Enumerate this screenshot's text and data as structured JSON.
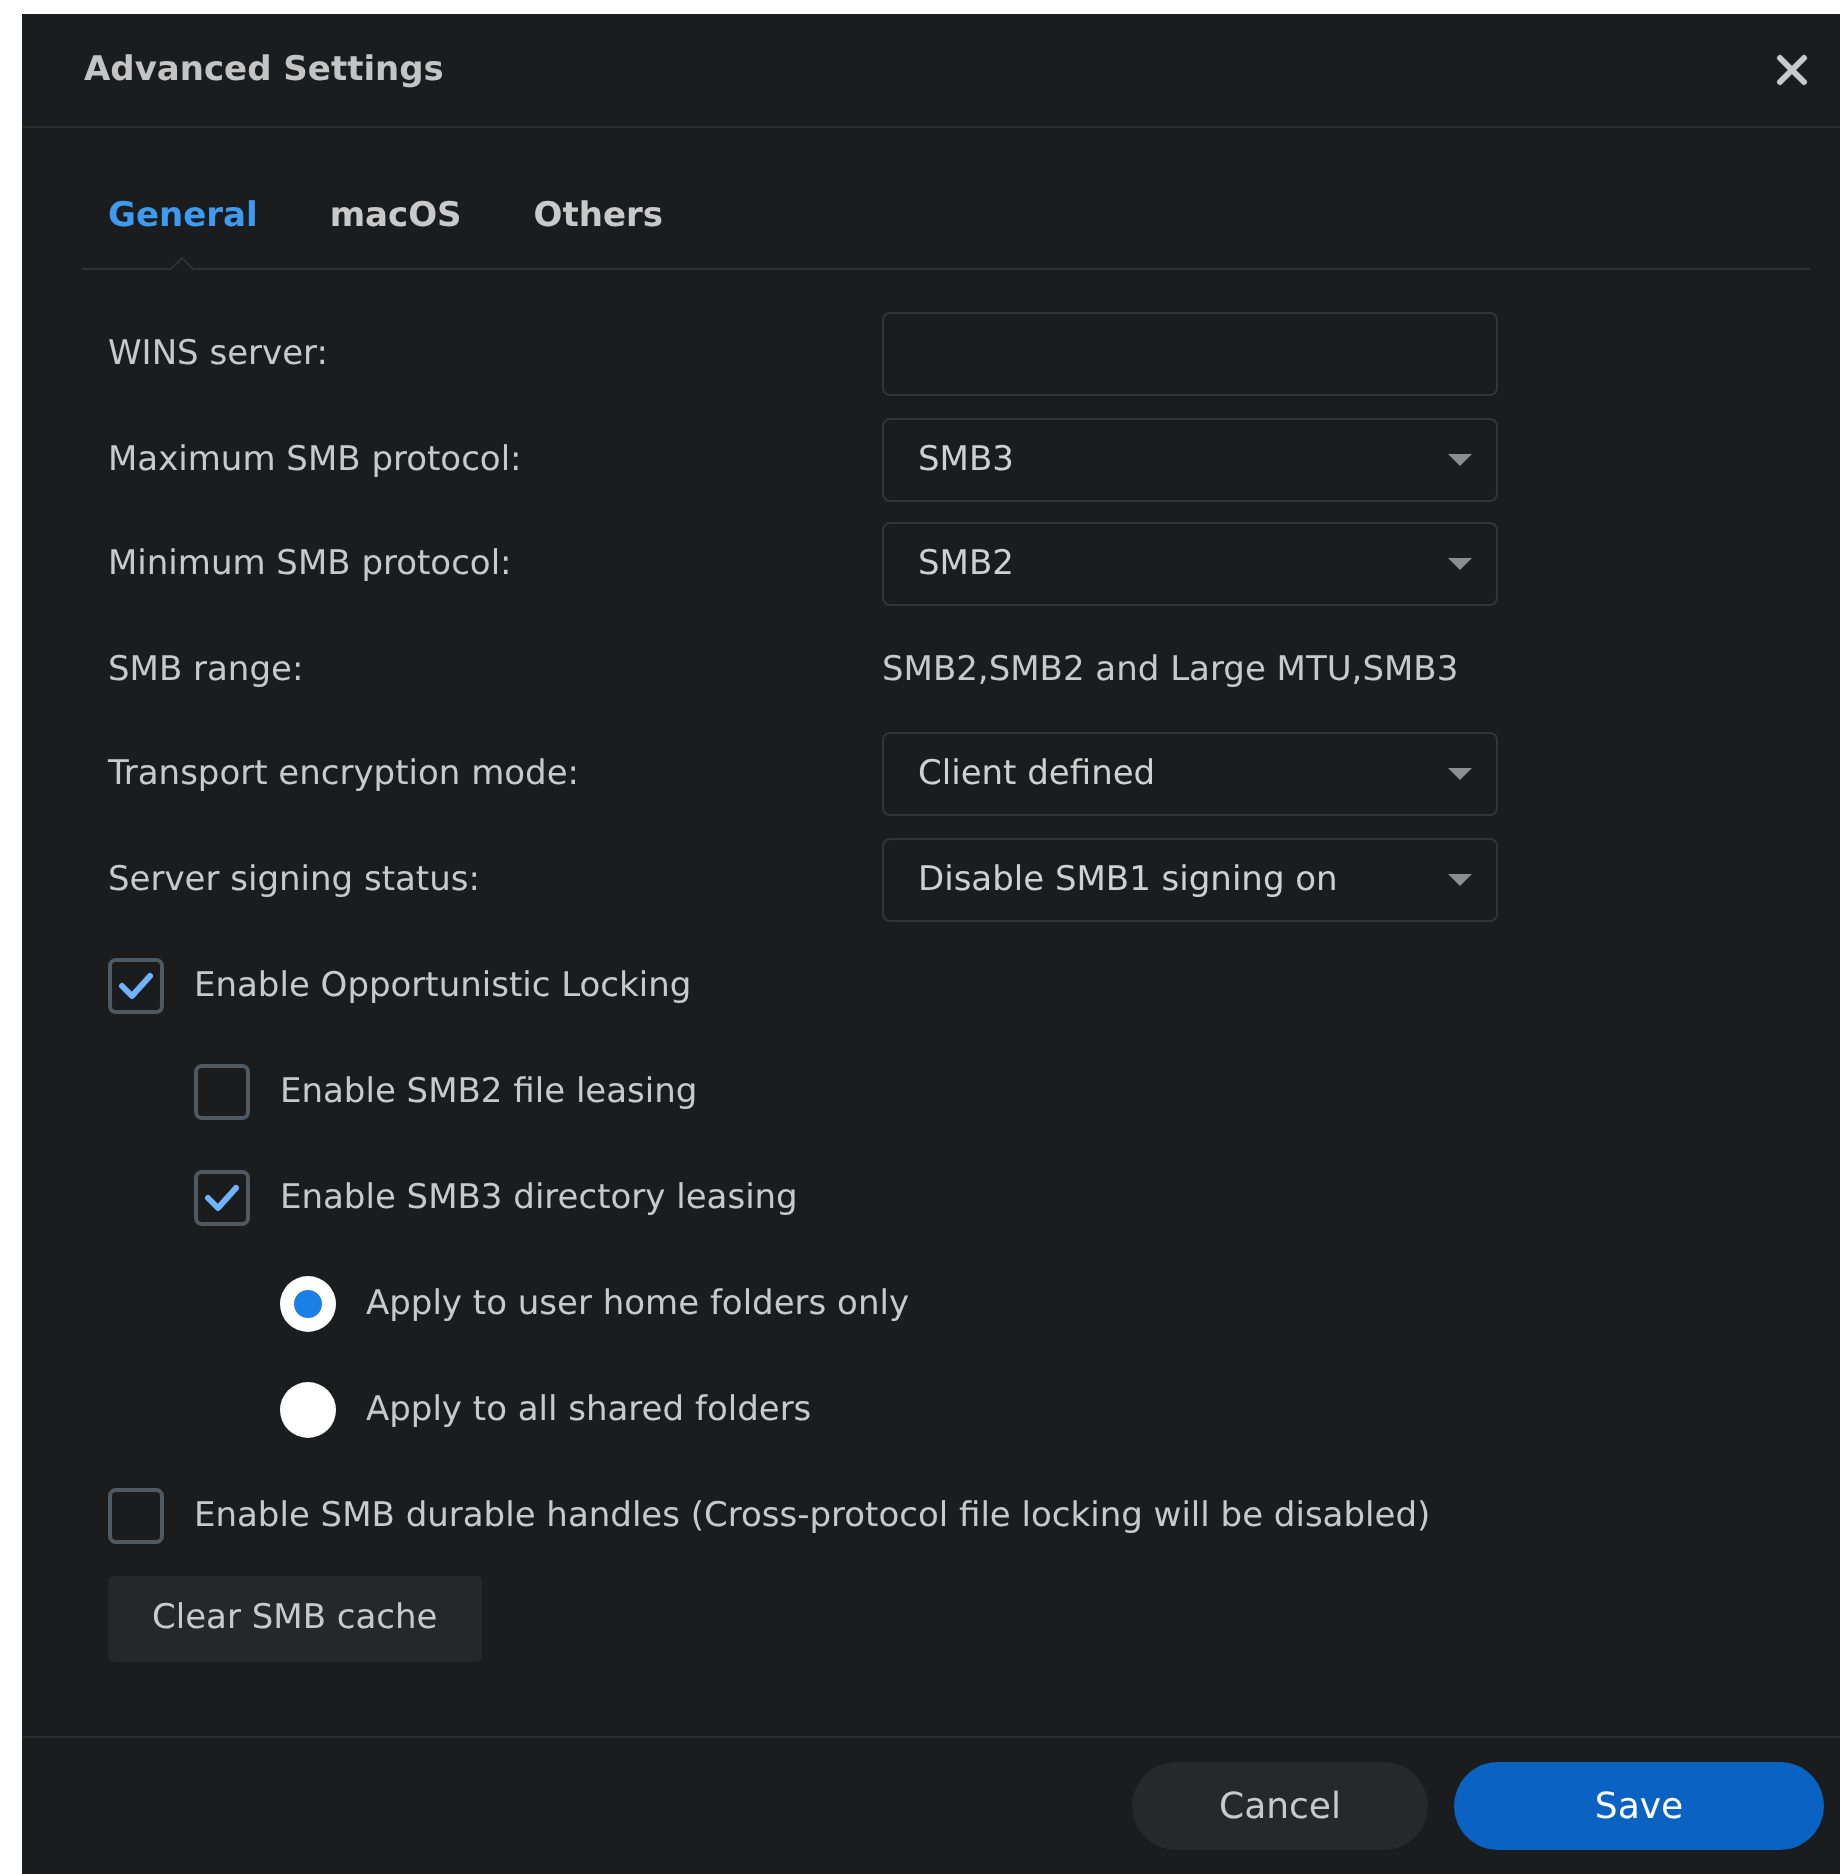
{
  "window": {
    "title": "Advanced Settings"
  },
  "tabs": [
    {
      "label": "General",
      "selected": true
    },
    {
      "label": "macOS",
      "selected": false
    },
    {
      "label": "Others",
      "selected": false
    }
  ],
  "fields": [
    {
      "label": "WINS server:",
      "kind": "text"
    },
    {
      "label": "Maximum SMB protocol:",
      "kind": "select",
      "value": "SMB3"
    },
    {
      "label": "Minimum SMB protocol:",
      "kind": "select",
      "value": "SMB2"
    },
    {
      "label": "SMB range:",
      "kind": "static",
      "value": "SMB2,SMB2 and Large MTU,SMB3"
    },
    {
      "label": "Transport encryption mode:",
      "kind": "select",
      "value": "Client defined"
    },
    {
      "label": "Server signing status:",
      "kind": "select",
      "value": "Disable SMB1 signing on"
    }
  ],
  "options": [
    {
      "kind": "checkbox",
      "label": "Enable Opportunistic Locking",
      "checked": true,
      "children": [
        {
          "kind": "checkbox",
          "label": "Enable SMB2 file leasing",
          "checked": false
        },
        {
          "kind": "checkbox",
          "label": "Enable SMB3 directory leasing",
          "checked": true,
          "children": [
            {
              "kind": "radio",
              "label": "Apply to user home folders only",
              "selected": true
            },
            {
              "kind": "radio",
              "label": "Apply to all shared folders",
              "selected": false
            }
          ]
        }
      ]
    },
    {
      "kind": "checkbox",
      "label": "Enable SMB durable handles (Cross-protocol file locking will be disabled)",
      "checked": false
    }
  ],
  "clear_button": "Clear SMB cache",
  "footer_buttons": [
    {
      "label": "Cancel",
      "kind": "secondary"
    },
    {
      "label": "Save",
      "kind": "primary"
    }
  ]
}
